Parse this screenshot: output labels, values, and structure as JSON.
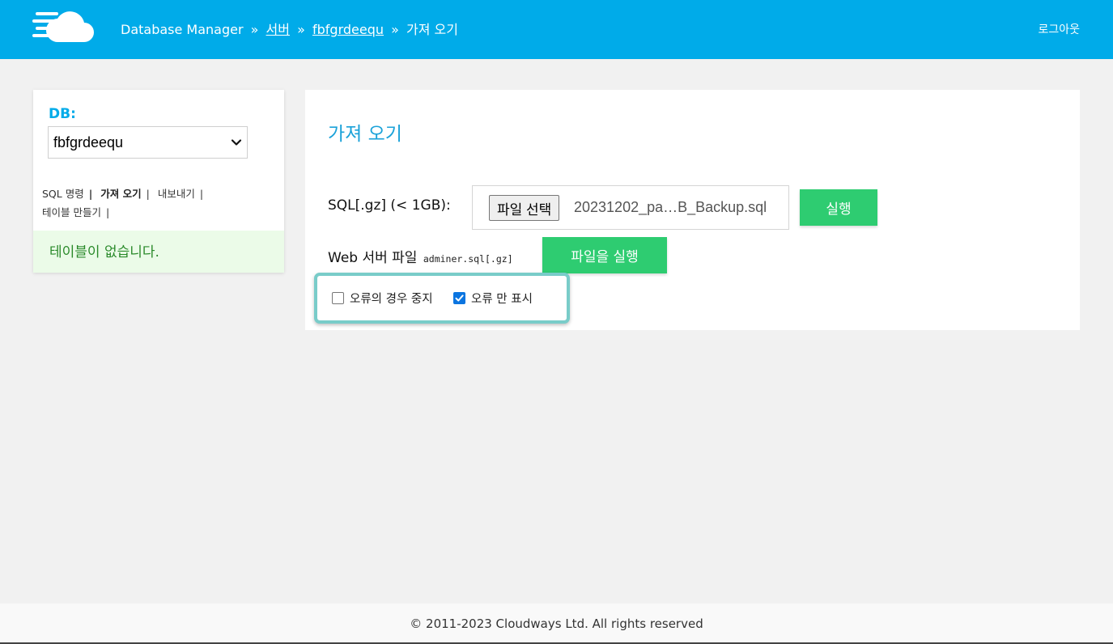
{
  "header": {
    "logo_icon": "cloud-logo-icon",
    "breadcrumb": {
      "root": "Database Manager",
      "separator": "»",
      "server": "서버",
      "database": "fbfgrdeequ",
      "current": "가져 오기"
    },
    "logout": "로그아웃"
  },
  "sidebar": {
    "db_label": "DB:",
    "db_selected": "fbfgrdeequ",
    "links": {
      "sql_command": "SQL 명령",
      "import": "가져 오기",
      "export": "내보내기",
      "create_table": "테이블 만들기",
      "pipe": "|"
    },
    "no_tables": "테이블이 없습니다."
  },
  "main": {
    "title": "가져 오기",
    "sql_label": "SQL[.gz] (< 1GB):",
    "choose_file": "파일 선택",
    "file_name": "20231202_pa…B_Backup.sql",
    "run_button": "실행",
    "web_label": "Web 서버 파일",
    "web_file": "adminer.sql[.gz]",
    "run_file_button": "파일을 실행",
    "options": {
      "stop_on_error": "오류의 경우 중지",
      "stop_on_error_checked": false,
      "errors_only": "오류 만 표시",
      "errors_only_checked": true
    }
  },
  "footer": {
    "copyright": "© 2011-2023 Cloudways Ltd. All rights reserved"
  },
  "colors": {
    "header": "#00abe9",
    "accent_button": "#2ecc71",
    "title": "#1ba2d9",
    "highlight_border": "#79ccc9",
    "success_bg": "#ebfbe8"
  }
}
